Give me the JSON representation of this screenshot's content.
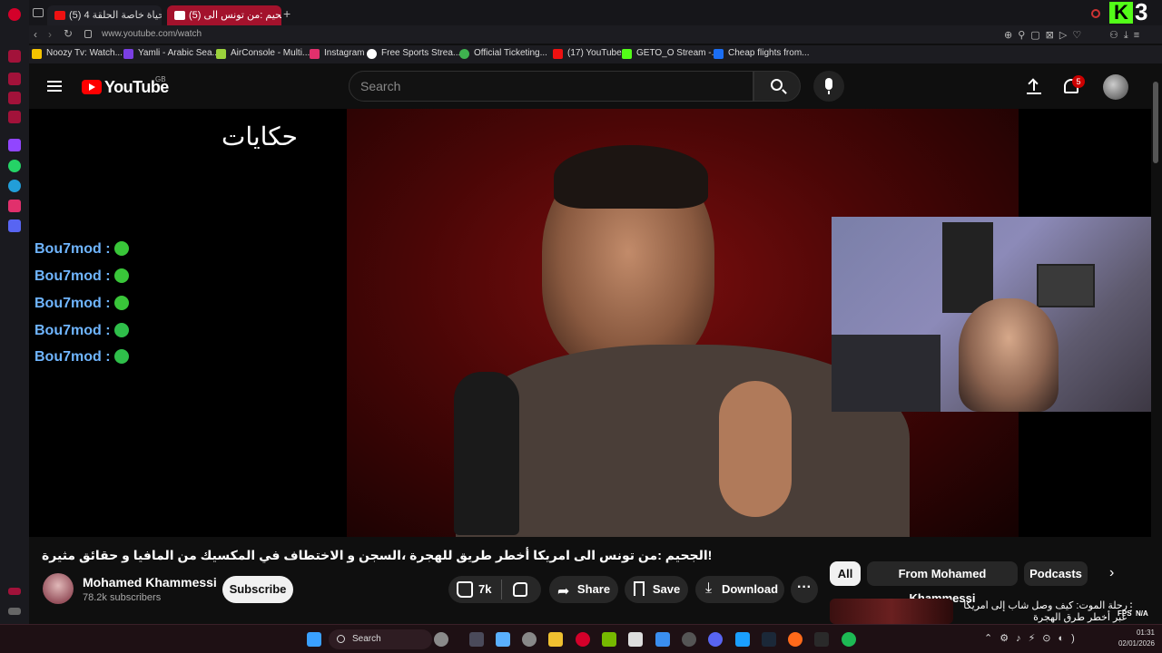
{
  "browser": {
    "tabs": [
      {
        "title": "(5) حياة خاصة الحلقة 4 - ube"
      },
      {
        "title": "(5) الجحيم :من تونس الى"
      }
    ],
    "new_tab": "+",
    "url": "www.youtube.com/watch",
    "bookmarks": [
      {
        "label": "Noozy Tv: Watch...",
        "color": "#f5c400"
      },
      {
        "label": "Yamli - Arabic Sea...",
        "color": "#7b3fe4"
      },
      {
        "label": "AirConsole - Multi...",
        "color": "#9bd23c"
      },
      {
        "label": "Instagram",
        "color": "#e1306c"
      },
      {
        "label": "Free Sports Strea...",
        "color": "#ffffff"
      },
      {
        "label": "Official Ticketing...",
        "color": "#3fb24f"
      },
      {
        "label": "(17) YouTube",
        "color": "#e11"
      },
      {
        "label": "GETO_O Stream -...",
        "color": "#53fc18"
      },
      {
        "label": "Cheap flights from...",
        "color": "#1b6ef3"
      }
    ]
  },
  "youtube": {
    "logo": "YouTube",
    "region": "GB",
    "search_placeholder": "Search",
    "notification_count": "5",
    "video_overlay_logo": "حكايات",
    "chat": [
      {
        "user": "Bou7mod :"
      },
      {
        "user": "Bou7mod :"
      },
      {
        "user": "Bou7mod :"
      },
      {
        "user": "Bou7mod :"
      },
      {
        "user": "Bou7mod :"
      }
    ],
    "video_title": "!الجحيم :من تونس الى امريكا أخطر طريق للهجرة ،السجن و الاختطاف في المكسيك من المافيا و حقائق مثيرة",
    "channel_name": "Mohamed Khammessi",
    "subscribers": "78.2k subscribers",
    "subscribe_label": "Subscribe",
    "likes": "7k",
    "share_label": "Share",
    "save_label": "Save",
    "download_label": "Download",
    "chips": [
      "All",
      "From Mohamed Khammessi",
      "Podcasts"
    ],
    "side_video_title": "رحلة الموت: كيف وصل شاب إلى أمريكا عبر أخطر طرق الهجرة"
  },
  "overlay": {
    "kick_logo": "K",
    "kick_number": "3",
    "fps_label": "FPS",
    "fps_value": "N/A"
  },
  "taskbar": {
    "search_label": "Search",
    "time": "01:31",
    "date": "02/01/2026"
  },
  "colors": {
    "accent_red": "#ff0000",
    "kick_green": "#53fc18",
    "chat_blue": "#6fb5ff"
  }
}
